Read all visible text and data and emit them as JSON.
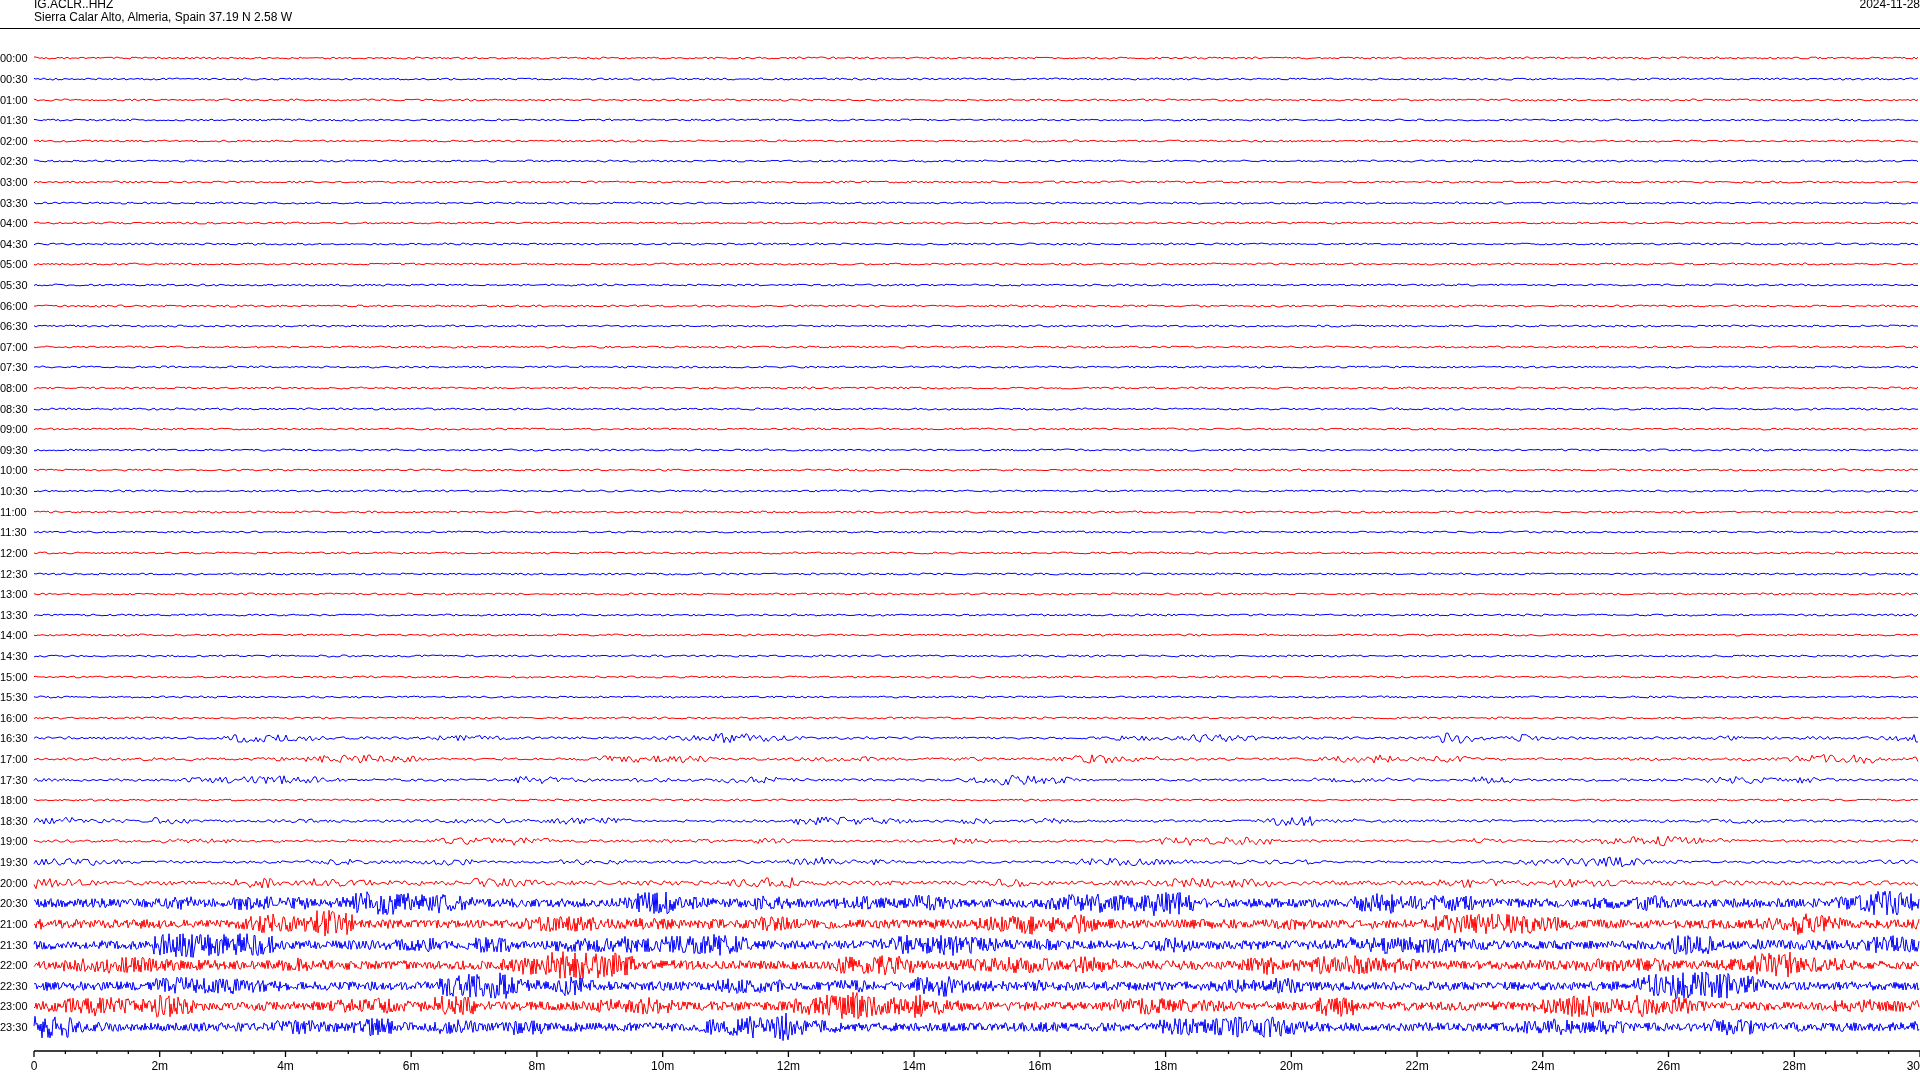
{
  "header": {
    "station": "IG.ACLR..HHZ",
    "location": "Sierra Calar Alto, Almeria, Spain  37.19 N 2.58 W",
    "date": "2024-11-28"
  },
  "traces": [
    {
      "time": "00:00",
      "color": "#ff0000",
      "kind": "quiet"
    },
    {
      "time": "00:30",
      "color": "#0000ff",
      "kind": "quiet"
    },
    {
      "time": "01:00",
      "color": "#ff0000",
      "kind": "quiet"
    },
    {
      "time": "01:30",
      "color": "#0000ff",
      "kind": "quiet"
    },
    {
      "time": "02:00",
      "color": "#ff0000",
      "kind": "quiet"
    },
    {
      "time": "02:30",
      "color": "#0000ff",
      "kind": "quiet"
    },
    {
      "time": "03:00",
      "color": "#ff0000",
      "kind": "quiet"
    },
    {
      "time": "03:30",
      "color": "#0000ff",
      "kind": "quiet"
    },
    {
      "time": "04:00",
      "color": "#ff0000",
      "kind": "quiet"
    },
    {
      "time": "04:30",
      "color": "#0000ff",
      "kind": "quiet"
    },
    {
      "time": "05:00",
      "color": "#ff0000",
      "kind": "quiet"
    },
    {
      "time": "05:30",
      "color": "#0000ff",
      "kind": "quiet"
    },
    {
      "time": "06:00",
      "color": "#ff0000",
      "kind": "quiet"
    },
    {
      "time": "06:30",
      "color": "#0000ff",
      "kind": "quiet"
    },
    {
      "time": "07:00",
      "color": "#ff0000",
      "kind": "quiet"
    },
    {
      "time": "07:30",
      "color": "#0000ff",
      "kind": "quiet"
    },
    {
      "time": "08:00",
      "color": "#ff0000",
      "kind": "quiet"
    },
    {
      "time": "08:30",
      "color": "#0000ff",
      "kind": "quiet"
    },
    {
      "time": "09:00",
      "color": "#ff0000",
      "kind": "quiet"
    },
    {
      "time": "09:30",
      "color": "#0000ff",
      "kind": "quiet"
    },
    {
      "time": "10:00",
      "color": "#ff0000",
      "kind": "quiet"
    },
    {
      "time": "10:30",
      "color": "#0000ff",
      "kind": "quiet"
    },
    {
      "time": "11:00",
      "color": "#ff0000",
      "kind": "quiet"
    },
    {
      "time": "11:30",
      "color": "#0000ff",
      "kind": "quiet"
    },
    {
      "time": "12:00",
      "color": "#ff0000",
      "kind": "quiet"
    },
    {
      "time": "12:30",
      "color": "#0000ff",
      "kind": "quiet"
    },
    {
      "time": "13:00",
      "color": "#ff0000",
      "kind": "quiet"
    },
    {
      "time": "13:30",
      "color": "#0000ff",
      "kind": "quiet"
    },
    {
      "time": "14:00",
      "color": "#ff0000",
      "kind": "quiet"
    },
    {
      "time": "14:30",
      "color": "#0000ff",
      "kind": "quiet"
    },
    {
      "time": "15:00",
      "color": "#ff0000",
      "kind": "quiet"
    },
    {
      "time": "15:30",
      "color": "#0000ff",
      "kind": "quiet"
    },
    {
      "time": "16:00",
      "color": "#ff0000",
      "kind": "quiet"
    },
    {
      "time": "16:30",
      "color": "#0000ff",
      "kind": "moderate"
    },
    {
      "time": "17:00",
      "color": "#ff0000",
      "kind": "moderate"
    },
    {
      "time": "17:30",
      "color": "#0000ff",
      "kind": "moderate"
    },
    {
      "time": "18:00",
      "color": "#ff0000",
      "kind": "quiet"
    },
    {
      "time": "18:30",
      "color": "#0000ff",
      "kind": "moderate"
    },
    {
      "time": "19:00",
      "color": "#ff0000",
      "kind": "moderate"
    },
    {
      "time": "19:30",
      "color": "#0000ff",
      "kind": "moderate"
    },
    {
      "time": "20:00",
      "color": "#ff0000",
      "kind": "elevated"
    },
    {
      "time": "20:30",
      "color": "#0000ff",
      "kind": "strong"
    },
    {
      "time": "21:00",
      "color": "#ff0000",
      "kind": "strong"
    },
    {
      "time": "21:30",
      "color": "#0000ff",
      "kind": "strong"
    },
    {
      "time": "22:00",
      "color": "#ff0000",
      "kind": "strong"
    },
    {
      "time": "22:30",
      "color": "#0000ff",
      "kind": "strong"
    },
    {
      "time": "23:00",
      "color": "#ff0000",
      "kind": "strong"
    },
    {
      "time": "23:30",
      "color": "#0000ff",
      "kind": "strong"
    }
  ],
  "axis": {
    "labels": [
      "0",
      "2m",
      "4m",
      "6m",
      "8m",
      "10m",
      "12m",
      "14m",
      "16m",
      "18m",
      "20m",
      "22m",
      "24m",
      "26m",
      "28m",
      "30"
    ]
  }
}
